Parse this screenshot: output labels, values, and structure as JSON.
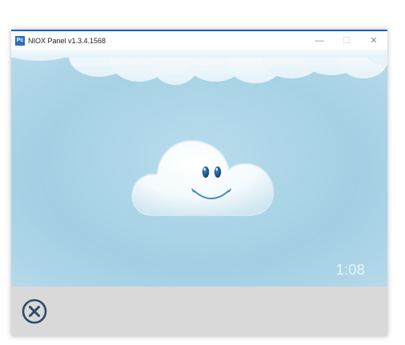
{
  "window": {
    "title": "NIOX Panel v1.3.4.1568",
    "app_icon_text": "Pc",
    "controls": {
      "minimize": "—",
      "maximize": "☐",
      "close": "✕"
    }
  },
  "main": {
    "timer": "1:08"
  },
  "bottom": {
    "close_button_icon": "close-circle-icon"
  },
  "colors": {
    "title_accent": "#1565c0",
    "sky": "#a9d3e6",
    "bottom_bar": "#d9d9d9",
    "close_icon": "#2f4a6b"
  }
}
